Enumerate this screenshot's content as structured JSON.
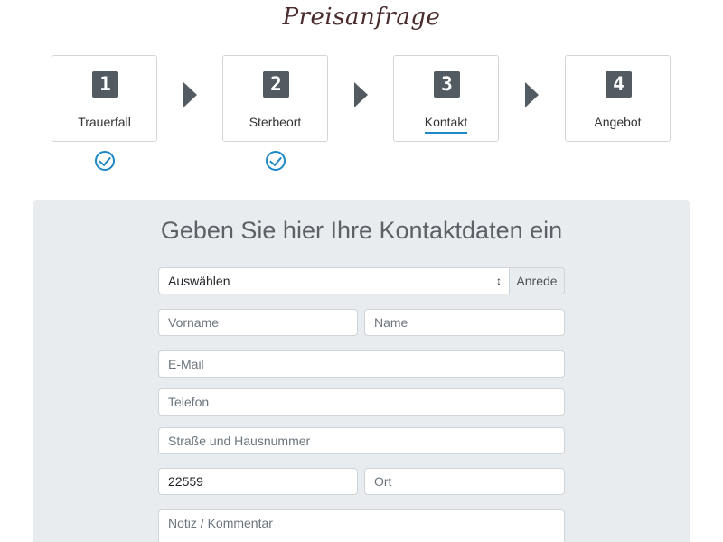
{
  "title": "Preisanfrage",
  "steps": [
    {
      "number": "1",
      "label": "Trauerfall",
      "done": true
    },
    {
      "number": "2",
      "label": "Sterbeort",
      "done": true
    },
    {
      "number": "3",
      "label": "Kontakt",
      "active": true
    },
    {
      "number": "4",
      "label": "Angebot"
    }
  ],
  "form": {
    "heading": "Geben Sie hier Ihre Kontaktdaten ein",
    "salutation": {
      "value": "Auswählen",
      "addon": "Anrede"
    },
    "first_name": {
      "placeholder": "Vorname"
    },
    "last_name": {
      "placeholder": "Name"
    },
    "email": {
      "placeholder": "E-Mail"
    },
    "phone": {
      "placeholder": "Telefon"
    },
    "street": {
      "placeholder": "Straße und Hausnummer"
    },
    "zip": {
      "value": "22559"
    },
    "city": {
      "placeholder": "Ort"
    },
    "note": {
      "placeholder": "Notiz / Kommentar"
    }
  },
  "colors": {
    "accent": "#1e87c5",
    "step_number_bg": "#525a62",
    "panel_bg": "#e9ecef",
    "title": "#4a2c2c"
  },
  "icons": {
    "arrow": "chevron-right-icon",
    "check": "check-circle-icon",
    "caret": "select-caret-icon"
  }
}
